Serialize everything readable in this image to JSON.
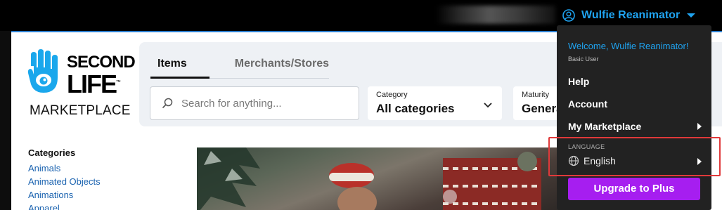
{
  "user": {
    "name": "Wulfie Reanimator"
  },
  "logo": {
    "line1": "SECOND",
    "line2": "LIFE",
    "tm": "™",
    "subtitle": "MARKETPLACE"
  },
  "tabs": [
    {
      "label": "Items",
      "active": true
    },
    {
      "label": "Merchants/Stores",
      "active": false
    }
  ],
  "search": {
    "placeholder": "Search for anything..."
  },
  "category_select": {
    "label": "Category",
    "value": "All categories"
  },
  "maturity_select": {
    "label": "Maturity",
    "value": "General"
  },
  "sidebar": {
    "title": "Categories",
    "items": [
      "Animals",
      "Animated Objects",
      "Animations",
      "Apparel"
    ]
  },
  "dropdown": {
    "welcome": "Welcome, Wulfie Reanimator!",
    "role": "Basic User",
    "items": [
      {
        "label": "Help"
      },
      {
        "label": "Account"
      },
      {
        "label": "My Marketplace"
      }
    ],
    "language_label": "LANGUAGE",
    "language_value": "English",
    "upgrade_label": "Upgrade to Plus"
  },
  "colors": {
    "accent": "#1fa3f0",
    "upgrade": "#a61ef0",
    "highlight": "#e0393a",
    "link": "#1b63b0"
  }
}
